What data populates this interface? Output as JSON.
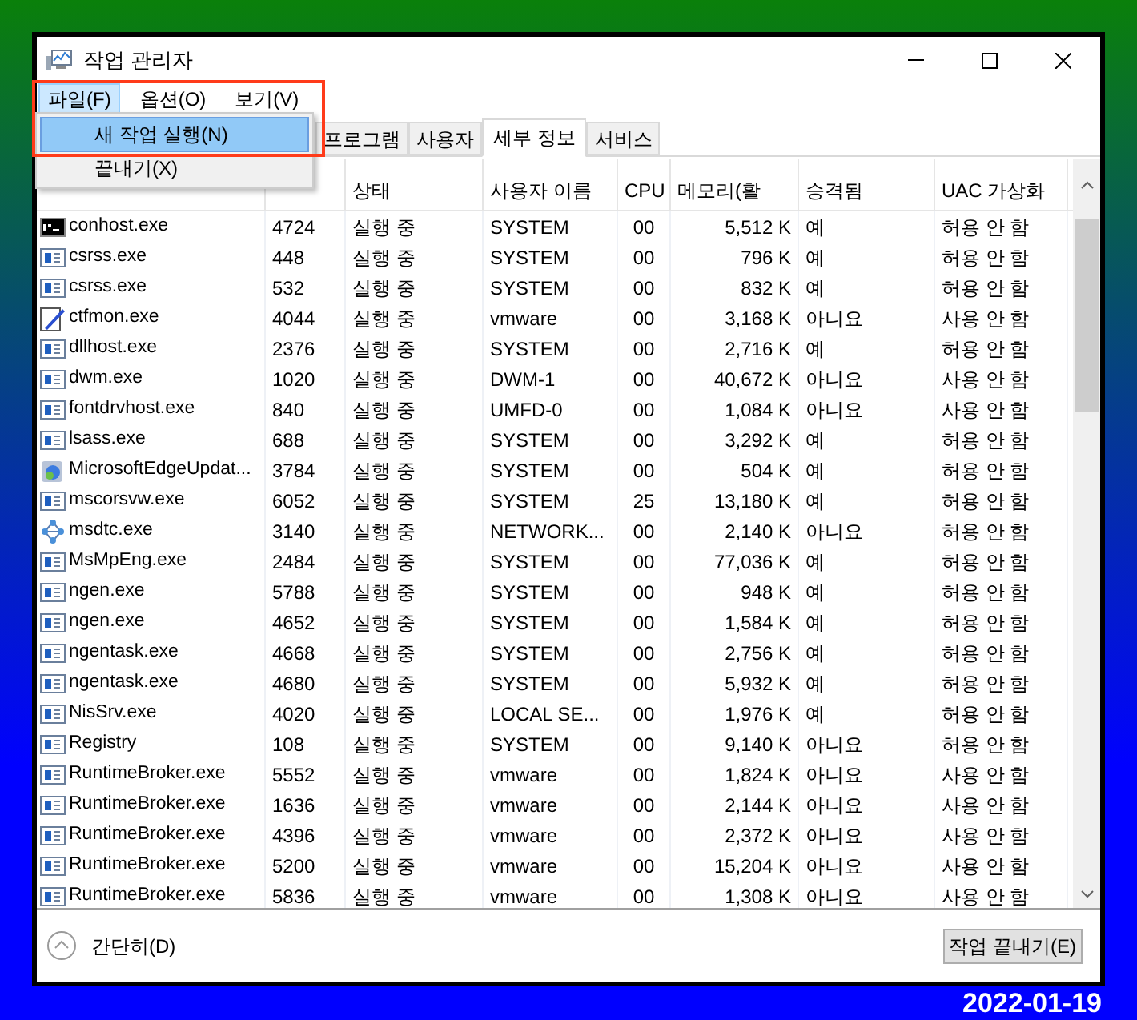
{
  "window": {
    "title": "작업 관리자"
  },
  "menu_bar": [
    {
      "label": "파일(F)",
      "selected": true
    },
    {
      "label": "옵션(O)",
      "selected": false
    },
    {
      "label": "보기(V)",
      "selected": false
    }
  ],
  "open_menu": {
    "items": [
      {
        "label": "새 작업 실행(N)",
        "selected": true
      },
      {
        "label": "끝내기(X)",
        "selected": false
      }
    ]
  },
  "tabs": [
    {
      "label": "프로그램",
      "selected": false
    },
    {
      "label": "사용자",
      "selected": false
    },
    {
      "label": "세부 정보",
      "selected": true
    },
    {
      "label": "서비스",
      "selected": false
    }
  ],
  "table": {
    "columns": [
      "",
      "",
      "상태",
      "사용자 이름",
      "CPU",
      "메모리(활",
      "승격됨",
      "UAC 가상화"
    ],
    "rows": [
      {
        "kind": "console",
        "cells": [
          "conhost.exe",
          "4724",
          "실행 중",
          "SYSTEM",
          "00",
          "5,512 K",
          "예",
          "허용 안 함"
        ]
      },
      {
        "kind": "window",
        "cells": [
          "csrss.exe",
          "448",
          "실행 중",
          "SYSTEM",
          "00",
          "796 K",
          "예",
          "허용 안 함"
        ]
      },
      {
        "kind": "window",
        "cells": [
          "csrss.exe",
          "532",
          "실행 중",
          "SYSTEM",
          "00",
          "832 K",
          "예",
          "허용 안 함"
        ]
      },
      {
        "kind": "pen",
        "cells": [
          "ctfmon.exe",
          "4044",
          "실행 중",
          "vmware",
          "00",
          "3,168 K",
          "아니요",
          "사용 안 함"
        ]
      },
      {
        "kind": "window",
        "cells": [
          "dllhost.exe",
          "2376",
          "실행 중",
          "SYSTEM",
          "00",
          "2,716 K",
          "예",
          "허용 안 함"
        ]
      },
      {
        "kind": "window",
        "cells": [
          "dwm.exe",
          "1020",
          "실행 중",
          "DWM-1",
          "00",
          "40,672 K",
          "아니요",
          "사용 안 함"
        ]
      },
      {
        "kind": "window",
        "cells": [
          "fontdrvhost.exe",
          "840",
          "실행 중",
          "UMFD-0",
          "00",
          "1,084 K",
          "아니요",
          "사용 안 함"
        ]
      },
      {
        "kind": "window",
        "cells": [
          "lsass.exe",
          "688",
          "실행 중",
          "SYSTEM",
          "00",
          "3,292 K",
          "예",
          "허용 안 함"
        ]
      },
      {
        "kind": "installer",
        "cells": [
          "MicrosoftEdgeUpdat...",
          "3784",
          "실행 중",
          "SYSTEM",
          "00",
          "504 K",
          "예",
          "허용 안 함"
        ]
      },
      {
        "kind": "window",
        "cells": [
          "mscorsvw.exe",
          "6052",
          "실행 중",
          "SYSTEM",
          "25",
          "13,180 K",
          "예",
          "허용 안 함"
        ]
      },
      {
        "kind": "network",
        "cells": [
          "msdtc.exe",
          "3140",
          "실행 중",
          "NETWORK...",
          "00",
          "2,140 K",
          "아니요",
          "허용 안 함"
        ]
      },
      {
        "kind": "window",
        "cells": [
          "MsMpEng.exe",
          "2484",
          "실행 중",
          "SYSTEM",
          "00",
          "77,036 K",
          "예",
          "허용 안 함"
        ]
      },
      {
        "kind": "window",
        "cells": [
          "ngen.exe",
          "5788",
          "실행 중",
          "SYSTEM",
          "00",
          "948 K",
          "예",
          "허용 안 함"
        ]
      },
      {
        "kind": "window",
        "cells": [
          "ngen.exe",
          "4652",
          "실행 중",
          "SYSTEM",
          "00",
          "1,584 K",
          "예",
          "허용 안 함"
        ]
      },
      {
        "kind": "window",
        "cells": [
          "ngentask.exe",
          "4668",
          "실행 중",
          "SYSTEM",
          "00",
          "2,756 K",
          "예",
          "허용 안 함"
        ]
      },
      {
        "kind": "window",
        "cells": [
          "ngentask.exe",
          "4680",
          "실행 중",
          "SYSTEM",
          "00",
          "5,932 K",
          "예",
          "허용 안 함"
        ]
      },
      {
        "kind": "window",
        "cells": [
          "NisSrv.exe",
          "4020",
          "실행 중",
          "LOCAL SE...",
          "00",
          "1,976 K",
          "예",
          "허용 안 함"
        ]
      },
      {
        "kind": "window",
        "cells": [
          "Registry",
          "108",
          "실행 중",
          "SYSTEM",
          "00",
          "9,140 K",
          "아니요",
          "허용 안 함"
        ]
      },
      {
        "kind": "window",
        "cells": [
          "RuntimeBroker.exe",
          "5552",
          "실행 중",
          "vmware",
          "00",
          "1,824 K",
          "아니요",
          "사용 안 함"
        ]
      },
      {
        "kind": "window",
        "cells": [
          "RuntimeBroker.exe",
          "1636",
          "실행 중",
          "vmware",
          "00",
          "2,144 K",
          "아니요",
          "사용 안 함"
        ]
      },
      {
        "kind": "window",
        "cells": [
          "RuntimeBroker.exe",
          "4396",
          "실행 중",
          "vmware",
          "00",
          "2,372 K",
          "아니요",
          "사용 안 함"
        ]
      },
      {
        "kind": "window",
        "cells": [
          "RuntimeBroker.exe",
          "5200",
          "실행 중",
          "vmware",
          "00",
          "15,204 K",
          "아니요",
          "사용 안 함"
        ]
      },
      {
        "kind": "window",
        "cells": [
          "RuntimeBroker.exe",
          "5836",
          "실행 중",
          "vmware",
          "00",
          "1,308 K",
          "아니요",
          "사용 안 함"
        ]
      }
    ]
  },
  "footer": {
    "toggle": "간단히(D)",
    "end_task_button": "작업 끝내기(E)"
  },
  "date_stamp": "2022-01-19"
}
